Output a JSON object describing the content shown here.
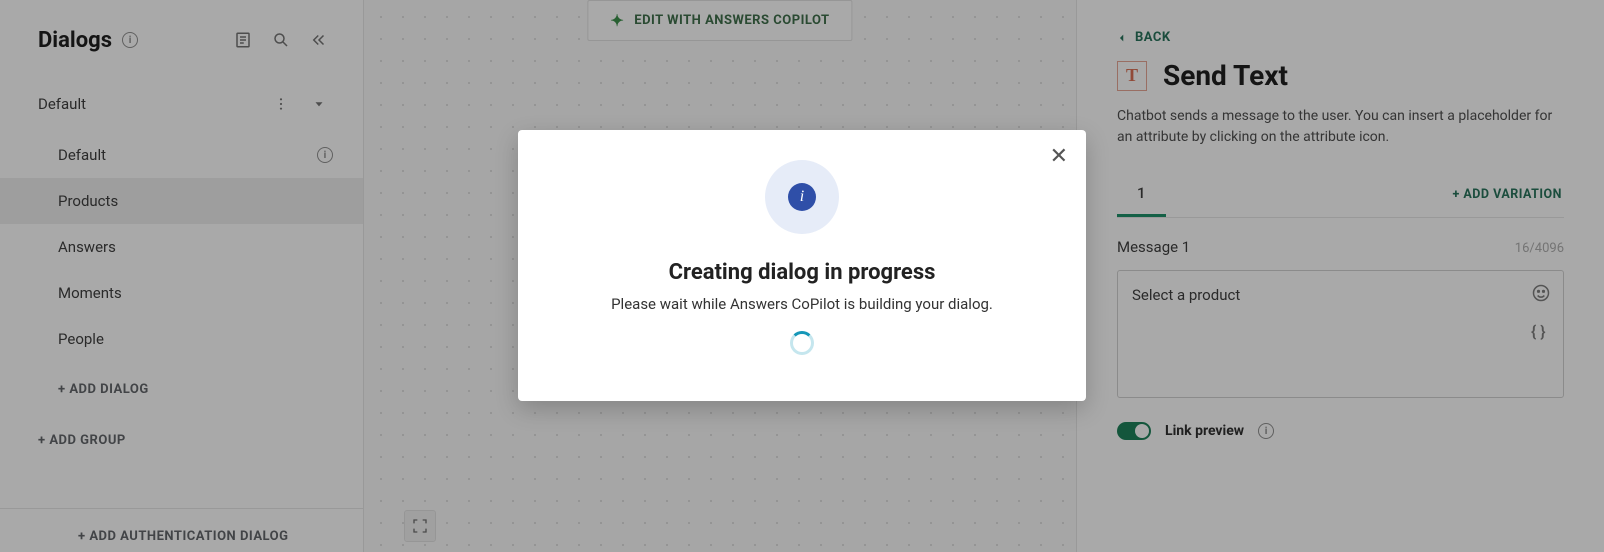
{
  "sidebar": {
    "title": "Dialogs",
    "group": {
      "label": "Default"
    },
    "items": [
      {
        "label": "Default",
        "selected": false,
        "info": true
      },
      {
        "label": "Products",
        "selected": true,
        "info": false
      },
      {
        "label": "Answers",
        "selected": false,
        "info": false
      },
      {
        "label": "Moments",
        "selected": false,
        "info": false
      },
      {
        "label": "People",
        "selected": false,
        "info": false
      }
    ],
    "add_dialog_label": "+ ADD DIALOG",
    "add_group_label": "+ ADD GROUP",
    "footer_link": "+ ADD AUTHENTICATION DIALOG"
  },
  "canvas": {
    "copilot_button": "EDIT WITH ANSWERS COPILOT"
  },
  "panel": {
    "back_label": "BACK",
    "text_icon": "T",
    "title": "Send Text",
    "description": "Chatbot sends a message to the user. You can insert a placeholder for an attribute by clicking on the attribute icon.",
    "tab_label": "1",
    "add_variation_label": "+ ADD VARIATION",
    "message_label": "Message 1",
    "char_count": "16/4096",
    "message_text": "Select a product",
    "link_preview_label": "Link preview"
  },
  "modal": {
    "title": "Creating dialog in progress",
    "subtitle": "Please wait while Answers CoPilot is building your dialog."
  }
}
